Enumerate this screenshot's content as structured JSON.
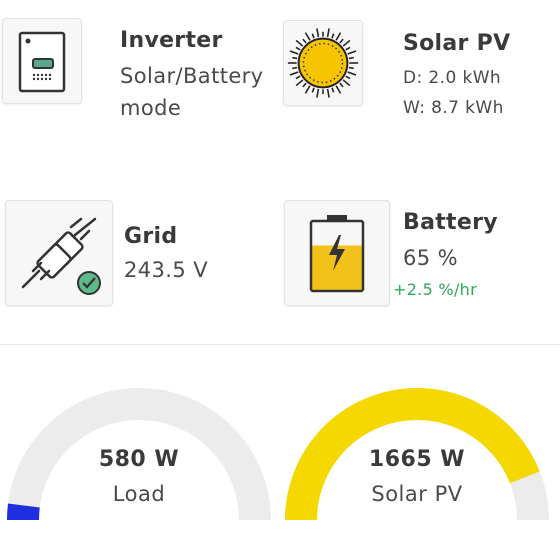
{
  "inverter": {
    "title": "Inverter",
    "mode_line1": "Solar/Battery",
    "mode_line2": "mode"
  },
  "solar": {
    "title": "Solar PV",
    "day": "D: 2.0 kWh",
    "week": "W: 8.7 kWh"
  },
  "grid": {
    "title": "Grid",
    "voltage": "243.5 V"
  },
  "battery": {
    "title": "Battery",
    "charge": "65 %",
    "rate": "+2.5 %/hr",
    "level": 0.65
  },
  "gauges": {
    "load": {
      "value": "580 W",
      "label": "Load",
      "fraction": 0.04,
      "color": "#1f2fe0"
    },
    "solar": {
      "value": "1665 W",
      "label": "Solar PV",
      "fraction": 0.88,
      "color": "#f5d800"
    }
  },
  "colors": {
    "track": "#ececec",
    "sun": "#f6c400",
    "battery_fill": "#f2c21b",
    "check": "#5dbb8a"
  }
}
